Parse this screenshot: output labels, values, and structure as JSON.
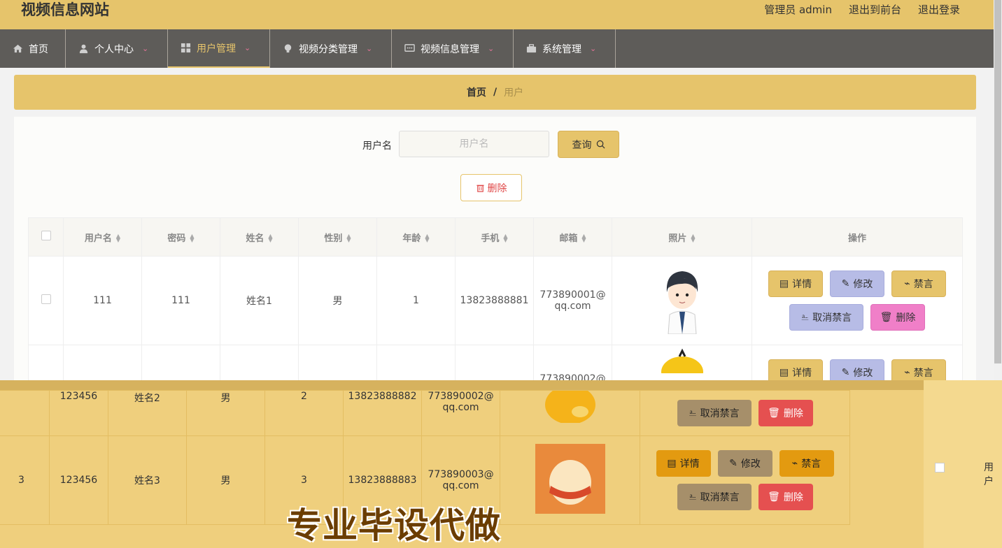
{
  "header": {
    "site_title": "视频信息网站",
    "admin": "管理员 admin",
    "to_front": "退出到前台",
    "logout": "退出登录"
  },
  "nav": [
    {
      "label": "首页",
      "icon": "home-icon",
      "active": false,
      "caret": false
    },
    {
      "label": "个人中心",
      "icon": "user-icon",
      "active": false,
      "caret": true
    },
    {
      "label": "用户管理",
      "icon": "grid-icon",
      "active": true,
      "caret": true
    },
    {
      "label": "视频分类管理",
      "icon": "bulb-icon",
      "active": false,
      "caret": true
    },
    {
      "label": "视频信息管理",
      "icon": "chat-icon",
      "active": false,
      "caret": true
    },
    {
      "label": "系统管理",
      "icon": "briefcase-icon",
      "active": false,
      "caret": true
    }
  ],
  "breadcrumb": {
    "home": "首页",
    "sep": "/",
    "current": "用户"
  },
  "search": {
    "label": "用户名",
    "placeholder": "用户名",
    "value": "",
    "query_button": "查询"
  },
  "delete_button": "删除",
  "table": {
    "columns": [
      "用户名",
      "密码",
      "姓名",
      "性别",
      "年龄",
      "手机",
      "邮箱",
      "照片",
      "操作"
    ],
    "rows": [
      {
        "username": "111",
        "password": "111",
        "name": "姓名1",
        "gender": "男",
        "age": "1",
        "phone": "13823888881",
        "email_a": "773890001@",
        "email_b": "qq.com"
      },
      {
        "username": "",
        "password": "",
        "name": "",
        "gender": "",
        "age": "",
        "phone": "",
        "email_a": "773890002@",
        "email_b": ""
      }
    ],
    "actions": {
      "detail": "详情",
      "edit": "修改",
      "ban": "禁言",
      "unban": "取消禁言",
      "delete": "删除"
    }
  },
  "overlay": {
    "rows": [
      {
        "c0": "",
        "c1": "123456",
        "c2": "姓名2",
        "c3": "男",
        "c4": "2",
        "c5": "13823888882",
        "email_a": "773890002@",
        "email_b": "qq.com"
      },
      {
        "c0": "3",
        "c1": "123456",
        "c2": "姓名3",
        "c3": "男",
        "c4": "3",
        "c5": "13823888883",
        "email_a": "773890003@",
        "email_b": "qq.com"
      }
    ],
    "watermark": "专业毕设代做",
    "right_label": "用户"
  },
  "colors": {
    "accent": "#e6c46b",
    "nav_bg": "#5e5c59",
    "edit": "#b7bce6",
    "delete": "#f07fc8"
  }
}
